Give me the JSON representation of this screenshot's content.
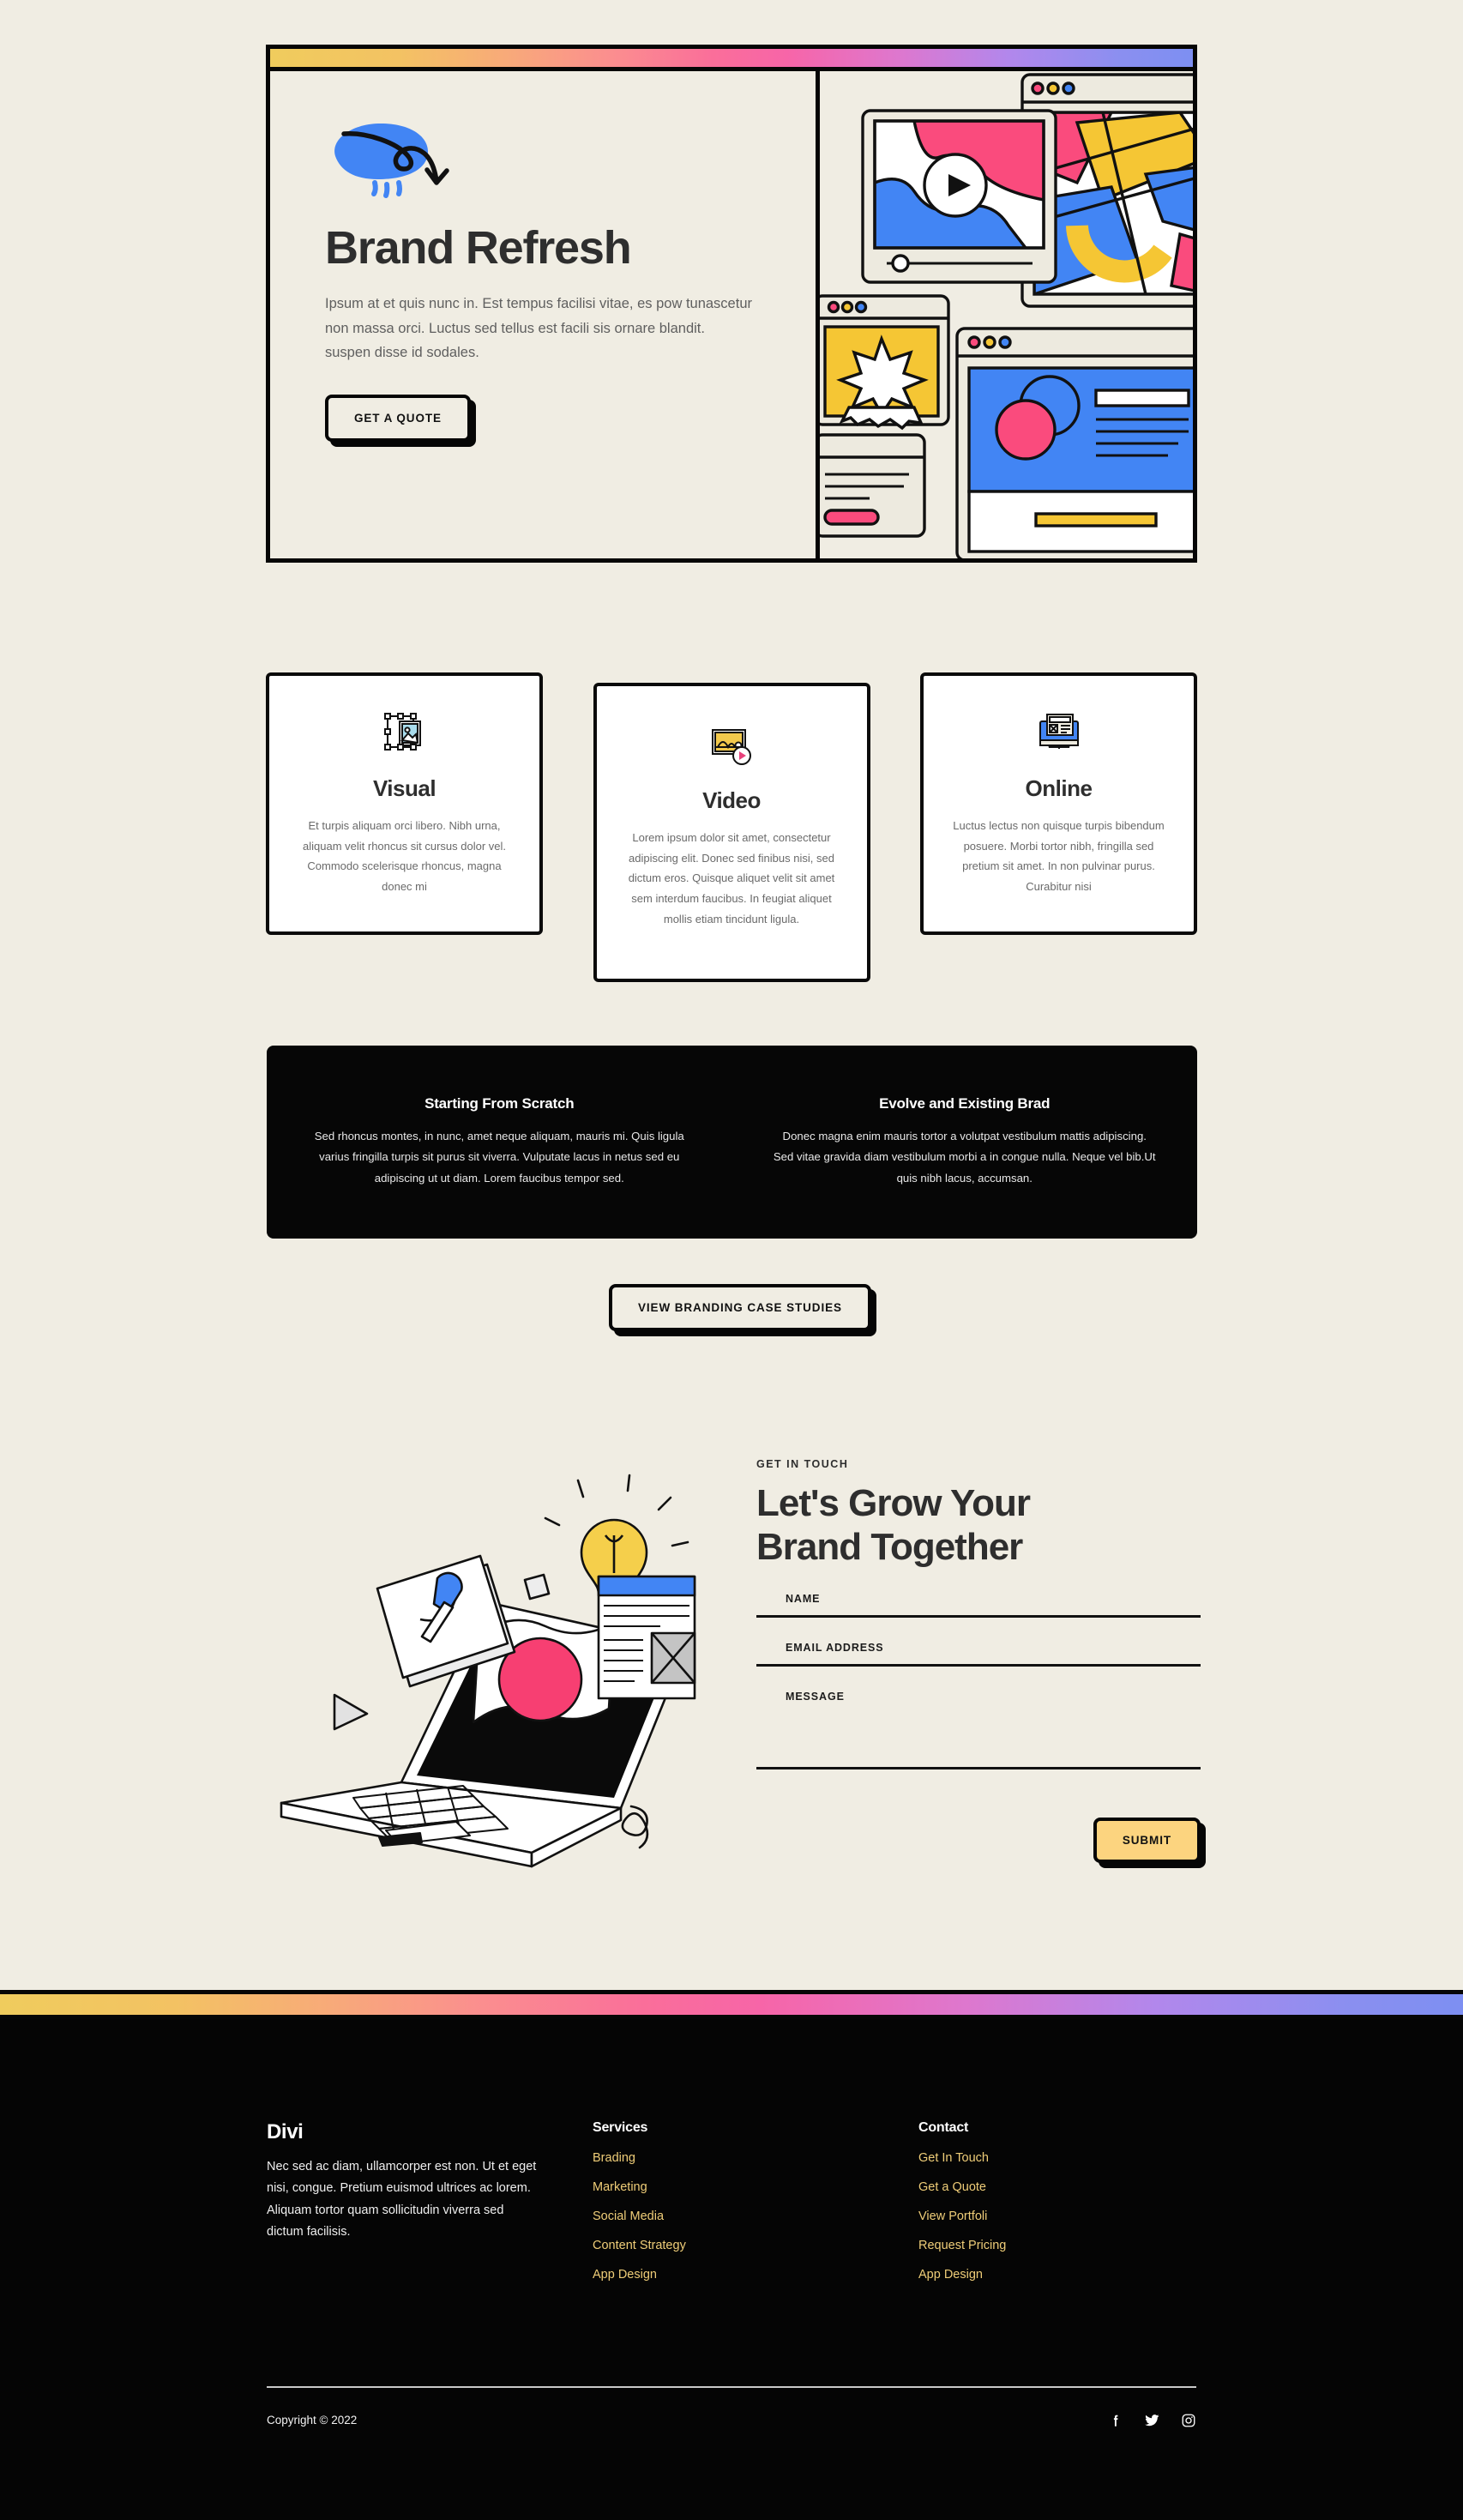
{
  "hero": {
    "title": "Brand Refresh",
    "paragraph": "Ipsum at et quis nunc in. Est tempus facilisi vitae, es pow tunascetur non massa orci. Luctus sed tellus est facili sis ornare blandit. suspen disse id sodales.",
    "cta_label": "GET A QUOTE",
    "squiggle_icon": "blue-blob-arrow-icon",
    "gradient_from": "#F0CC5D",
    "gradient_mid": "#FA6E9A",
    "gradient_to": "#7D8FF2",
    "illustration_name": "browser-windows-collage-illustration"
  },
  "cards": [
    {
      "icon": "image-frame-icon",
      "title": "Visual",
      "text": "Et turpis aliquam orci libero. Nibh urna, aliquam velit rhoncus sit cursus dolor vel. Commodo scelerisque rhoncus, magna donec mi"
    },
    {
      "icon": "video-play-icon",
      "title": "Video",
      "text": "Lorem ipsum dolor sit amet, consectetur adipiscing elit. Donec sed finibus nisi, sed dictum eros. Quisque aliquet velit sit amet sem interdum faucibus. In feugiat aliquet mollis etiam tincidunt ligula."
    },
    {
      "icon": "desktop-monitor-icon",
      "title": "Online",
      "text": "Luctus lectus non quisque turpis bibendum posuere. Morbi tortor nibh, fringilla sed pretium sit amet. In non pulvinar purus. Curabitur nisi"
    }
  ],
  "black_panel": {
    "columns": [
      {
        "title": "Starting From Scratch",
        "text": "Sed rhoncus montes, in nunc, amet neque aliquam, mauris mi. Quis ligula varius fringilla turpis sit purus sit viverra. Vulputate lacus in netus sed eu adipiscing ut ut diam. Lorem faucibus tempor sed."
      },
      {
        "title": "Evolve and Existing Brad",
        "text": "Donec magna enim mauris tortor a volutpat vestibulum mattis adipiscing. Sed vitae gravida diam vestibulum morbi a in congue nulla. Neque vel bib.Ut quis nibh lacus, accumsan."
      }
    ]
  },
  "case_studies_button": "VIEW BRANDING CASE STUDIES",
  "contact": {
    "eyebrow": "GET IN TOUCH",
    "title_line1": "Let's Grow Your",
    "title_line2": "Brand Together",
    "illustration_name": "laptop-ideas-illustration",
    "fields": [
      {
        "label": "NAME",
        "value": "",
        "placeholder": ""
      },
      {
        "label": "EMAIL ADDRESS",
        "value": "",
        "placeholder": ""
      },
      {
        "label": "MESSAGE",
        "value": "",
        "placeholder": ""
      }
    ],
    "submit_label": "SUBMIT",
    "submit_color": "#FCD47F"
  },
  "footer": {
    "brand": "Divi",
    "about": "Nec sed ac diam, ullamcorper est non. Ut et eget nisi, congue. Pretium euismod ultrices ac lorem. Aliquam tortor quam sollicitudin viverra sed dictum facilisis.",
    "columns": [
      {
        "title": "Services",
        "links": [
          "Brading",
          "Marketing",
          "Social Media",
          "Content Strategy",
          "App Design"
        ]
      },
      {
        "title": "Contact",
        "links": [
          "Get In Touch",
          "Get a Quote",
          "View Portfoli",
          "Request Pricing",
          "App Design"
        ]
      }
    ],
    "copyright": "Copyright © 2022",
    "social": [
      "facebook-icon",
      "twitter-icon",
      "instagram-icon"
    ],
    "link_color": "#EFCD78"
  }
}
